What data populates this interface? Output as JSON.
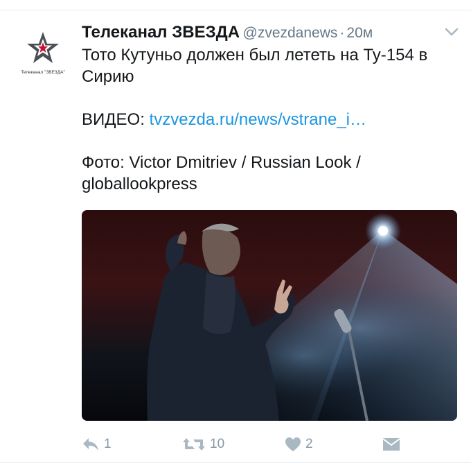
{
  "tweet": {
    "avatar_caption": "Телеканал \"ЗВЕЗДА\"",
    "display_name": "Телеканал ЗВЕЗДА",
    "handle": "@zvezdanews",
    "separator": "·",
    "time": "20м",
    "text_line1": "Тото Кутуньо должен был лететь на Ту-154 в Сирию",
    "video_label": "ВИДЕО: ",
    "video_link": "tvzvezda.ru/news/vstrane_i…",
    "photo_credit": "Фото: Victor Dmitriev / Russian Look / globallookpress"
  },
  "actions": {
    "reply_icon": "reply-icon",
    "reply_count": "1",
    "retweet_icon": "retweet-icon",
    "retweet_count": "10",
    "like_icon": "heart-icon",
    "like_count": "2",
    "dm_icon": "envelope-icon"
  },
  "colors": {
    "link": "#1b95e0",
    "muted": "#657786",
    "action": "#8899a6",
    "logo_dark": "#4a4f55",
    "logo_red": "#c8102e"
  }
}
